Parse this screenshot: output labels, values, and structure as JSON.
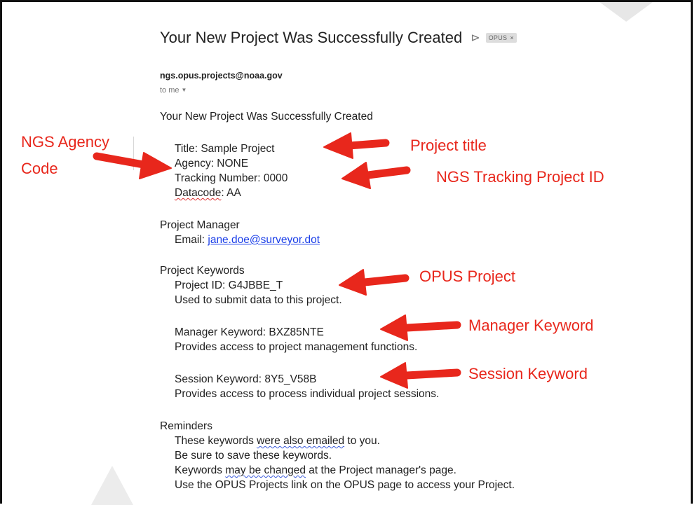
{
  "email": {
    "subject": "Your New Project Was Successfully Created",
    "label_chip": "OPUS",
    "label_chip_close": "×",
    "importance_icon": "importance-marker-icon",
    "sender": "ngs.opus.projects@noaa.gov",
    "recipient": "to me",
    "body_heading": "Your New Project Was Successfully Created",
    "project": {
      "title_line": "Title: Sample Project",
      "agency_line": "Agency: NONE",
      "tracking_line": "Tracking Number: 0000",
      "datacode_label": "Datacode",
      "datacode_value": ": AA"
    },
    "manager": {
      "heading": "Project Manager",
      "email_label": "Email: ",
      "email_value": "jane.doe@surveyor.dot"
    },
    "keywords": {
      "heading": "Project Keywords",
      "project_id_line": "Project ID: G4JBBE_T",
      "project_id_desc": "Used to submit data to this project.",
      "manager_keyword_line": "Manager Keyword: BXZ85NTE",
      "manager_keyword_desc": "Provides access to project management functions.",
      "session_keyword_line": "Session Keyword: 8Y5_V58B",
      "session_keyword_desc": "Provides access to process individual project sessions."
    },
    "reminders": {
      "heading": "Reminders",
      "line1_pre": "These keywords ",
      "line1_squig": "were also emailed",
      "line1_post": " to you.",
      "line2": "Be sure to save these keywords.",
      "line3_pre": "Keywords ",
      "line3_squig": "may be changed",
      "line3_post": " at the Project manager's page.",
      "line4": "Use the OPUS Projects link on the OPUS page to access your Project."
    }
  },
  "annotations": {
    "ngs_agency_code_line1": "NGS Agency",
    "ngs_agency_code_line2": "Code",
    "project_title": "Project title",
    "ngs_tracking_project_id": "NGS Tracking Project ID",
    "opus_project": "OPUS Project",
    "manager_keyword": "Manager Keyword",
    "session_keyword": "Session Keyword",
    "color": "#e8271c"
  }
}
